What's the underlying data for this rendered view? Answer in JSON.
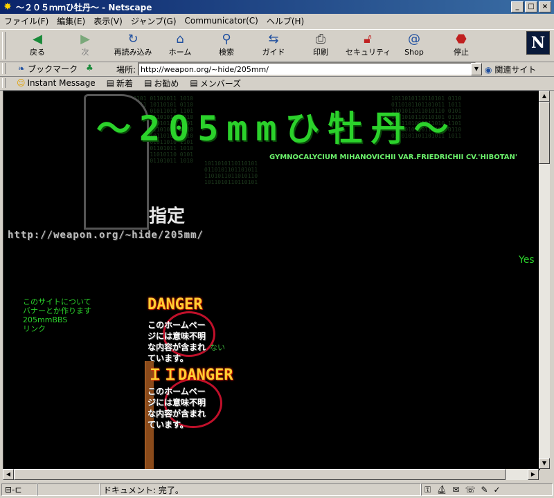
{
  "window": {
    "title": "～２０５ｍｍひ牡丹～ - Netscape"
  },
  "menu": [
    "ファイル(F)",
    "編集(E)",
    "表示(V)",
    "ジャンプ(G)",
    "Communicator(C)",
    "ヘルプ(H)"
  ],
  "toolbar": [
    {
      "label": "戻る",
      "icon": "back-arrow-icon"
    },
    {
      "label": "次",
      "icon": "forward-arrow-icon"
    },
    {
      "label": "再読み込み",
      "icon": "reload-icon"
    },
    {
      "label": "ホーム",
      "icon": "home-icon"
    },
    {
      "label": "検索",
      "icon": "search-icon"
    },
    {
      "label": "ガイド",
      "icon": "guide-icon"
    },
    {
      "label": "印刷",
      "icon": "print-icon"
    },
    {
      "label": "セキュリティ",
      "icon": "security-icon"
    },
    {
      "label": "Shop",
      "icon": "shop-icon"
    },
    {
      "label": "停止",
      "icon": "stop-icon"
    }
  ],
  "location": {
    "bookmarks_label": "ブックマーク",
    "location_label": "場所:",
    "url": "http://weapon.org/~hide/205mm/",
    "related_label": "関連サイト"
  },
  "personal": [
    "Instant Message",
    "新着",
    "お勧め",
    "メンバーズ"
  ],
  "page": {
    "title": "～205mmひ牡丹～",
    "subtitle": "GYMNOCALYCIUM MIHANOVICHII VAR.FRIEDRICHII CV.'HIBOTAN'",
    "shitei": "指定",
    "url_text": "http://weapon.org/~hide/205mm/",
    "marquee": "Yes",
    "links": [
      "このサイトについて",
      "バナーとか作ります",
      "205mmBBS",
      "リンク"
    ],
    "danger_label": "DANGER",
    "danger_label2": "DANGER",
    "danger_prefix": "ＩＩ",
    "danger_text": "このホームペー\nジには意味不明\nな内容が含まれ\nています。",
    "danger_text2": "このホームペー\nジには意味不明\nな内容が含まれ\nています。",
    "green_text": "ない"
  },
  "status": {
    "text": "ドキュメント: 完了。"
  }
}
